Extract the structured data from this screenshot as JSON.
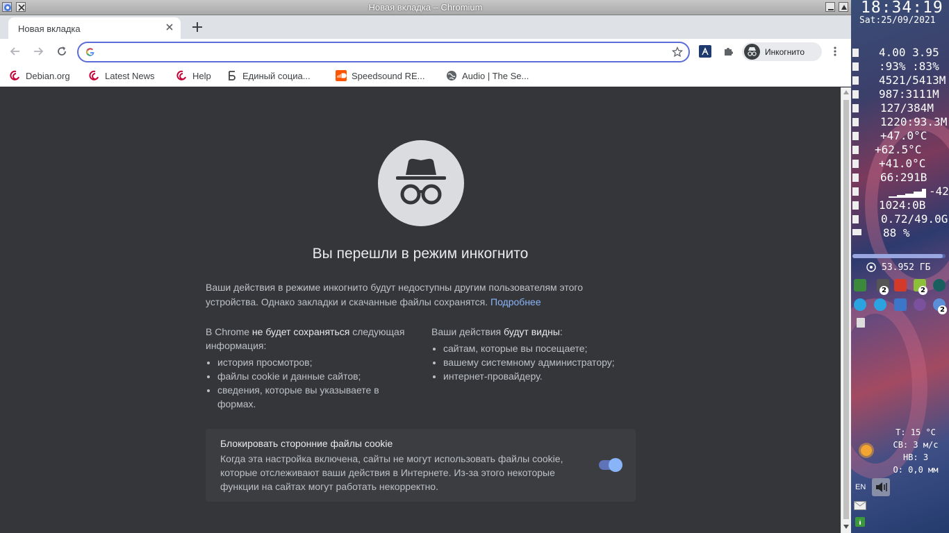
{
  "window": {
    "title": "Новая вкладка – Chromium"
  },
  "tabs": [
    {
      "label": "Новая вкладка"
    }
  ],
  "omnibox": {
    "value": "",
    "placeholder": ""
  },
  "profile": {
    "label": "Инкогнито"
  },
  "bookmarks": [
    {
      "label": "Debian.org",
      "icon": "debian-icon"
    },
    {
      "label": "Latest News",
      "icon": "debian-icon"
    },
    {
      "label": "Help",
      "icon": "debian-icon"
    },
    {
      "label": "Единый социа...",
      "icon": "b-letter-icon"
    },
    {
      "label": "Speedsound RE...",
      "icon": "soundcloud-icon"
    },
    {
      "label": "Audio | The Se...",
      "icon": "globe-icon"
    }
  ],
  "page": {
    "heading": "Вы перешли в режим инкогнито",
    "intro": "Ваши действия в режиме инкогнито будут недоступны другим пользователям этого устройства. Однако закладки и скачанные файлы сохранятся.",
    "learn_more": "Подробнее",
    "not_saved": {
      "heading_pre": "В Chrome ",
      "heading_bold": "не будет сохраняться",
      "heading_post": " следующая информация:",
      "items": [
        "история просмотров;",
        "файлы cookie и данные сайтов;",
        "сведения, которые вы указываете в формах."
      ]
    },
    "visible_to": {
      "heading_pre": "Ваши действия ",
      "heading_bold": "будут видны",
      "heading_post": ":",
      "items": [
        "сайтам, которые вы посещаете;",
        "вашему системному администратору;",
        "интернет-провайдеру."
      ]
    },
    "cookie_card": {
      "title": "Блокировать сторонние файлы cookie",
      "description": "Когда эта настройка включена, сайты не могут использовать файлы cookie, которые отслеживают ваши действия в Интернете. Из-за этого некоторые функции на сайтах могут работать некорректно.",
      "enabled": true
    }
  },
  "desktop": {
    "time": "18:34:19",
    "date": "Sat:25/09/2021",
    "stats": [
      "4.00 3.95",
      ":93% :83%",
      "4521/5413M",
      "987:3111M",
      "127/384M",
      "1220:93.3M",
      "+47.0°C",
      "+62.5°C",
      "+41.0°C",
      "66:291B",
      "-42",
      "1024:0B",
      "0.72/49.0G",
      "88 %"
    ],
    "volume": 0.97,
    "disk": "53.952 ГБ",
    "tray_badges": [
      "2",
      "2",
      "2"
    ],
    "weather": [
      "T: 15 °C",
      "СВ: 3 м/с",
      "НВ: 3",
      "O: 0,0 мм"
    ],
    "lang": "EN"
  },
  "colors": {
    "accent": "#8ab4f8",
    "omnibox_focus": "#5b6cd8",
    "content_bg": "#35363a"
  }
}
